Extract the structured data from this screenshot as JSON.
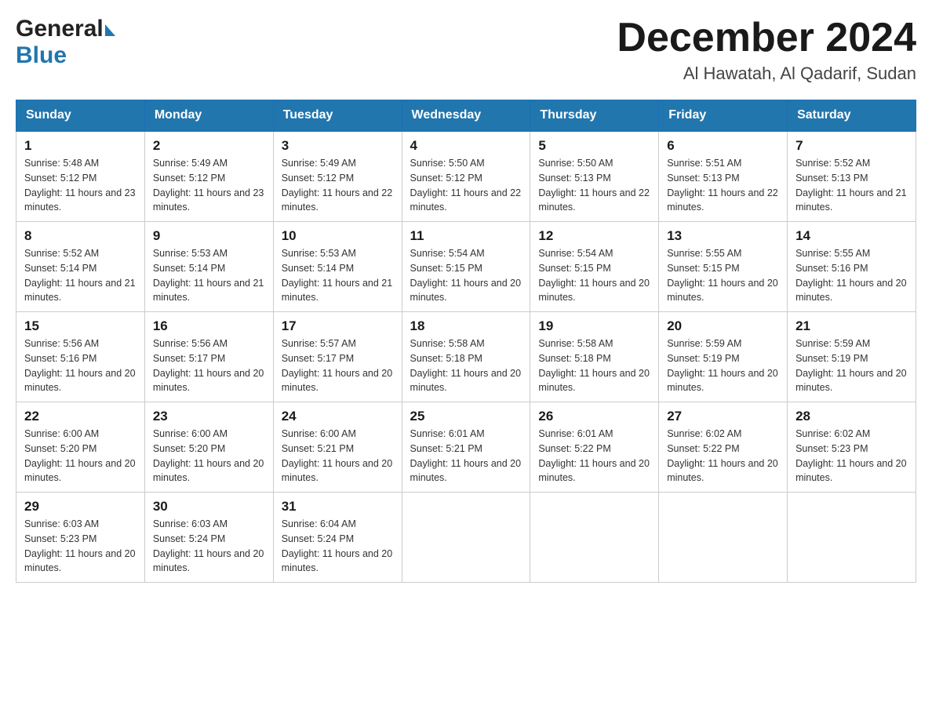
{
  "header": {
    "logo_general": "General",
    "logo_blue": "Blue",
    "month_title": "December 2024",
    "location": "Al Hawatah, Al Qadarif, Sudan"
  },
  "days_of_week": [
    "Sunday",
    "Monday",
    "Tuesday",
    "Wednesday",
    "Thursday",
    "Friday",
    "Saturday"
  ],
  "weeks": [
    [
      {
        "day": "1",
        "sunrise": "5:48 AM",
        "sunset": "5:12 PM",
        "daylight": "11 hours and 23 minutes."
      },
      {
        "day": "2",
        "sunrise": "5:49 AM",
        "sunset": "5:12 PM",
        "daylight": "11 hours and 23 minutes."
      },
      {
        "day": "3",
        "sunrise": "5:49 AM",
        "sunset": "5:12 PM",
        "daylight": "11 hours and 22 minutes."
      },
      {
        "day": "4",
        "sunrise": "5:50 AM",
        "sunset": "5:12 PM",
        "daylight": "11 hours and 22 minutes."
      },
      {
        "day": "5",
        "sunrise": "5:50 AM",
        "sunset": "5:13 PM",
        "daylight": "11 hours and 22 minutes."
      },
      {
        "day": "6",
        "sunrise": "5:51 AM",
        "sunset": "5:13 PM",
        "daylight": "11 hours and 22 minutes."
      },
      {
        "day": "7",
        "sunrise": "5:52 AM",
        "sunset": "5:13 PM",
        "daylight": "11 hours and 21 minutes."
      }
    ],
    [
      {
        "day": "8",
        "sunrise": "5:52 AM",
        "sunset": "5:14 PM",
        "daylight": "11 hours and 21 minutes."
      },
      {
        "day": "9",
        "sunrise": "5:53 AM",
        "sunset": "5:14 PM",
        "daylight": "11 hours and 21 minutes."
      },
      {
        "day": "10",
        "sunrise": "5:53 AM",
        "sunset": "5:14 PM",
        "daylight": "11 hours and 21 minutes."
      },
      {
        "day": "11",
        "sunrise": "5:54 AM",
        "sunset": "5:15 PM",
        "daylight": "11 hours and 20 minutes."
      },
      {
        "day": "12",
        "sunrise": "5:54 AM",
        "sunset": "5:15 PM",
        "daylight": "11 hours and 20 minutes."
      },
      {
        "day": "13",
        "sunrise": "5:55 AM",
        "sunset": "5:15 PM",
        "daylight": "11 hours and 20 minutes."
      },
      {
        "day": "14",
        "sunrise": "5:55 AM",
        "sunset": "5:16 PM",
        "daylight": "11 hours and 20 minutes."
      }
    ],
    [
      {
        "day": "15",
        "sunrise": "5:56 AM",
        "sunset": "5:16 PM",
        "daylight": "11 hours and 20 minutes."
      },
      {
        "day": "16",
        "sunrise": "5:56 AM",
        "sunset": "5:17 PM",
        "daylight": "11 hours and 20 minutes."
      },
      {
        "day": "17",
        "sunrise": "5:57 AM",
        "sunset": "5:17 PM",
        "daylight": "11 hours and 20 minutes."
      },
      {
        "day": "18",
        "sunrise": "5:58 AM",
        "sunset": "5:18 PM",
        "daylight": "11 hours and 20 minutes."
      },
      {
        "day": "19",
        "sunrise": "5:58 AM",
        "sunset": "5:18 PM",
        "daylight": "11 hours and 20 minutes."
      },
      {
        "day": "20",
        "sunrise": "5:59 AM",
        "sunset": "5:19 PM",
        "daylight": "11 hours and 20 minutes."
      },
      {
        "day": "21",
        "sunrise": "5:59 AM",
        "sunset": "5:19 PM",
        "daylight": "11 hours and 20 minutes."
      }
    ],
    [
      {
        "day": "22",
        "sunrise": "6:00 AM",
        "sunset": "5:20 PM",
        "daylight": "11 hours and 20 minutes."
      },
      {
        "day": "23",
        "sunrise": "6:00 AM",
        "sunset": "5:20 PM",
        "daylight": "11 hours and 20 minutes."
      },
      {
        "day": "24",
        "sunrise": "6:00 AM",
        "sunset": "5:21 PM",
        "daylight": "11 hours and 20 minutes."
      },
      {
        "day": "25",
        "sunrise": "6:01 AM",
        "sunset": "5:21 PM",
        "daylight": "11 hours and 20 minutes."
      },
      {
        "day": "26",
        "sunrise": "6:01 AM",
        "sunset": "5:22 PM",
        "daylight": "11 hours and 20 minutes."
      },
      {
        "day": "27",
        "sunrise": "6:02 AM",
        "sunset": "5:22 PM",
        "daylight": "11 hours and 20 minutes."
      },
      {
        "day": "28",
        "sunrise": "6:02 AM",
        "sunset": "5:23 PM",
        "daylight": "11 hours and 20 minutes."
      }
    ],
    [
      {
        "day": "29",
        "sunrise": "6:03 AM",
        "sunset": "5:23 PM",
        "daylight": "11 hours and 20 minutes."
      },
      {
        "day": "30",
        "sunrise": "6:03 AM",
        "sunset": "5:24 PM",
        "daylight": "11 hours and 20 minutes."
      },
      {
        "day": "31",
        "sunrise": "6:04 AM",
        "sunset": "5:24 PM",
        "daylight": "11 hours and 20 minutes."
      },
      null,
      null,
      null,
      null
    ]
  ]
}
